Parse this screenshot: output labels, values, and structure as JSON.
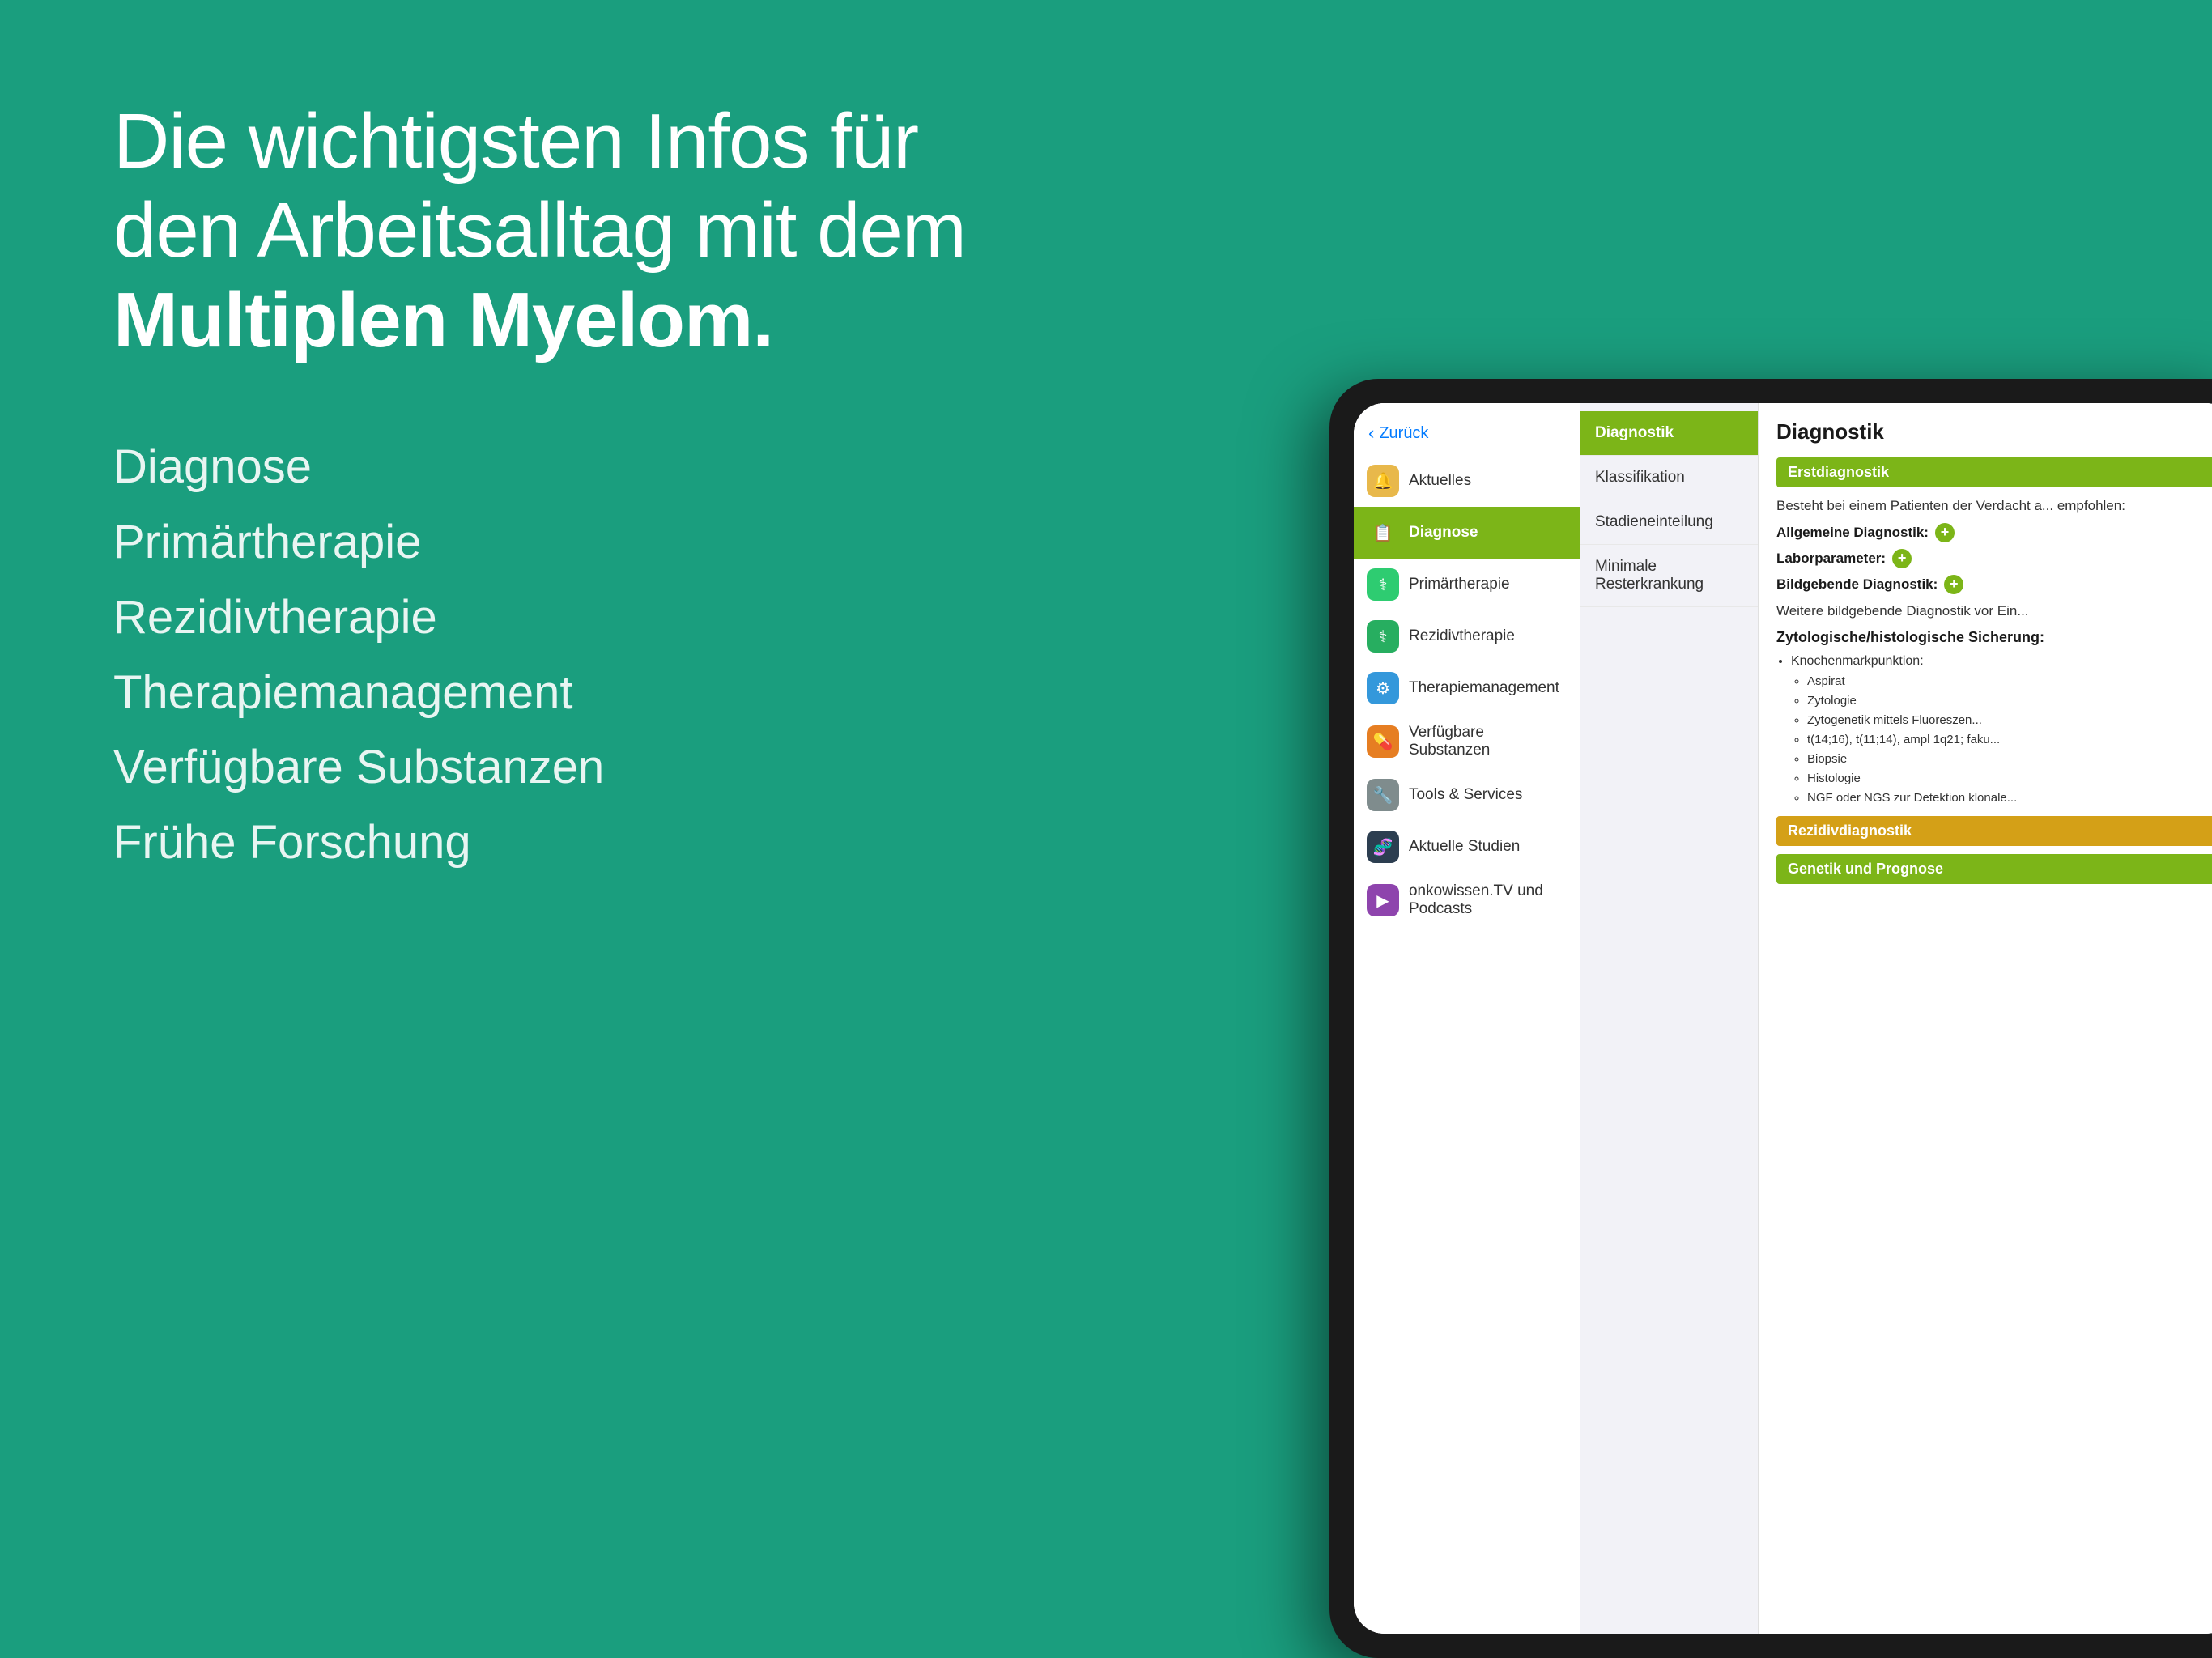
{
  "background_color": "#1a9e7e",
  "headline": {
    "line1": "Die wichtigsten Infos für",
    "line2": "den Arbeitsalltag mit dem",
    "bold": "Multiplen Myelom."
  },
  "nav_items": [
    "Diagnose",
    "Primärtherapie",
    "Rezidivtherapie",
    "Therapiemanagement",
    "Verfügbare Substanzen",
    "Frühe Forschung"
  ],
  "sidebar": {
    "back_label": "Zurück",
    "items": [
      {
        "id": "aktuelles",
        "label": "Aktuelles",
        "icon": "🔔",
        "icon_class": "icon-aktuelles",
        "active": false
      },
      {
        "id": "diagnose",
        "label": "Diagnose",
        "icon": "📋",
        "icon_class": "icon-diagnose",
        "active": true
      },
      {
        "id": "primartherapie",
        "label": "Primärtherapie",
        "icon": "⚕",
        "icon_class": "icon-primartherapie",
        "active": false
      },
      {
        "id": "rezidivtherapie",
        "label": "Rezidivtherapie",
        "icon": "⚕",
        "icon_class": "icon-rezidivtherapie",
        "active": false
      },
      {
        "id": "therapiemanagement",
        "label": "Therapiemanagement",
        "icon": "⚙",
        "icon_class": "icon-therapiemanagement",
        "active": false
      },
      {
        "id": "substanzen",
        "label": "Verfügbare Substanzen",
        "icon": "💊",
        "icon_class": "icon-substanzen",
        "active": false
      },
      {
        "id": "tools",
        "label": "Tools & Services",
        "icon": "🔧",
        "icon_class": "icon-tools",
        "active": false
      },
      {
        "id": "studien",
        "label": "Aktuelle Studien",
        "icon": "🧬",
        "icon_class": "icon-studien",
        "active": false
      },
      {
        "id": "onkowissen",
        "label": "onkowissen.TV und Podcasts",
        "icon": "▶",
        "icon_class": "icon-onkowissen",
        "active": false
      }
    ]
  },
  "middle_col": {
    "items": [
      {
        "label": "Diagnostik",
        "active": true
      },
      {
        "label": "Klassifikation",
        "active": false
      },
      {
        "label": "Stadieneinteilung",
        "active": false
      },
      {
        "label": "Minimale Resterkrankung",
        "active": false
      }
    ]
  },
  "content": {
    "title": "Diagnostik",
    "section1": {
      "header": "Erstdiagnostik",
      "intro": "Besteht bei einem Patienten der Verdacht a... empfohlen:",
      "expand_rows": [
        {
          "label": "Allgemeine Diagnostik:",
          "btn": "+"
        },
        {
          "label": "Laborparameter:",
          "btn": "+"
        },
        {
          "label": "Bildgebende Diagnostik:",
          "btn": "+"
        }
      ],
      "further_text": "Weitere bildgebende Diagnostik vor Ein...",
      "zytologische_title": "Zytologische/histologische Sicherung:",
      "bullets": [
        {
          "label": "Knochenmarkpunktion:",
          "sub": [
            "Aspirat",
            "Zytologie",
            "Zytogenetik mittels Fluoreszen...",
            "t(14;16), t(11;14), ampl 1q21; faku...",
            "Biopsie",
            "Histologie",
            "NGF oder NGS zur Detektion klonale..."
          ]
        }
      ]
    },
    "section2_header": "Rezidivdiagnostik",
    "section3_header": "Genetik und Prognose"
  }
}
